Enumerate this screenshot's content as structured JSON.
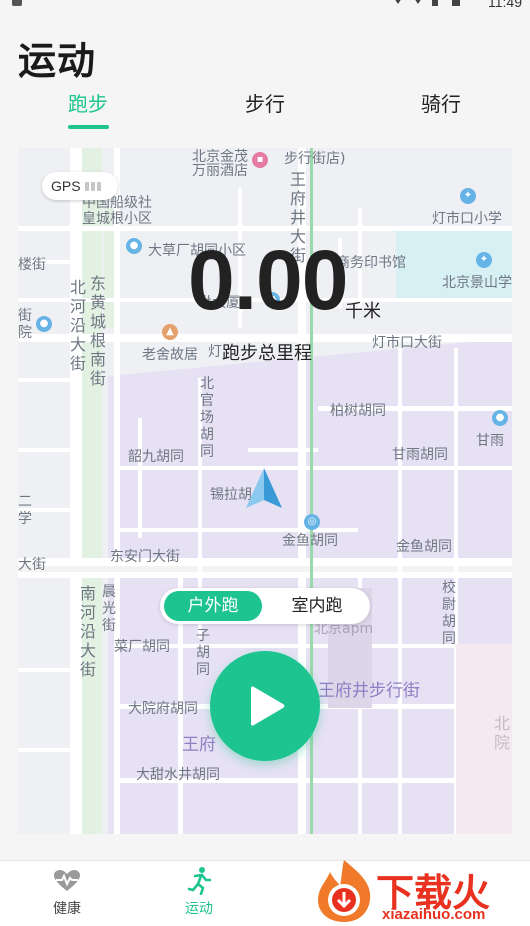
{
  "status_bar": {
    "time": "11:49"
  },
  "page_title": "运动",
  "tabs": [
    {
      "label": "跑步",
      "active": true
    },
    {
      "label": "步行",
      "active": false
    },
    {
      "label": "骑行",
      "active": false
    }
  ],
  "map": {
    "labels": {
      "l1": "北京金茂",
      "l2": "万丽酒店",
      "l3": "步行街店)",
      "l4": "中国船级社",
      "l5": "皇城根小区",
      "l6": "灯市口小学",
      "l7": "大草厂胡同小区",
      "l8": "商务印书馆",
      "l9": "北京景山学",
      "l10": "楼街",
      "l11": "世大厦",
      "l12": "老舍故居",
      "l13": "灯市口大街",
      "l14": "柏树胡同",
      "l15": "甘雨",
      "l16": "韶九胡同",
      "l17": "甘雨胡同",
      "l18": "锡拉胡",
      "l19": "金鱼胡同",
      "l20": "金鱼胡同",
      "l21": "东安门大街",
      "l22": "大街",
      "l23": "菜厂胡同",
      "l24": "北京apm",
      "l25": "王府井步行街",
      "l26": "大院府胡同",
      "l27": "王府",
      "l28": "大甜水井胡同",
      "l29": "街院",
      "l30": "二学",
      "v1": "王府井大街",
      "v2": "东黄城根南街",
      "v3": "北河沿大街",
      "v4": "北官场胡同",
      "v5": "南河沿大街",
      "v6": "晨光街",
      "v7": "西堂子胡同",
      "v8": "校尉胡同",
      "v9": "北院",
      "v10": "灯"
    }
  },
  "gps": {
    "label": "GPS",
    "signal_bars_filled": 0,
    "signal_bars_total": 3
  },
  "distance": {
    "value": "0.00",
    "unit": "千米",
    "caption": "跑步总里程"
  },
  "modes": {
    "outdoor": "户外跑",
    "indoor": "室内跑",
    "selected": "outdoor"
  },
  "bottom_nav": [
    {
      "label": "健康",
      "icon": "heart-pulse-icon",
      "active": false
    },
    {
      "label": "运动",
      "icon": "running-icon",
      "active": true
    }
  ],
  "watermark": {
    "text": "下载火",
    "url": "xiazaihuo.com"
  },
  "colors": {
    "accent": "#1dc48f",
    "watermark": "#e8311f"
  }
}
